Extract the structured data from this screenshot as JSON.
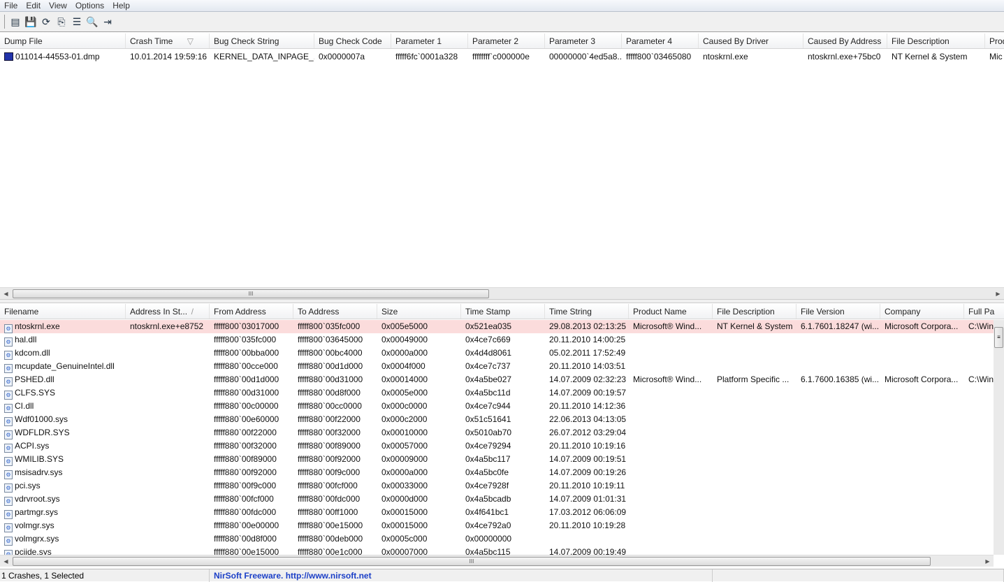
{
  "menu": [
    "File",
    "Edit",
    "View",
    "Options",
    "Help"
  ],
  "toolbar": [
    {
      "name": "html-report-icon",
      "glyph": "▤"
    },
    {
      "name": "save-icon",
      "glyph": "💾"
    },
    {
      "name": "refresh-icon",
      "glyph": "⟳"
    },
    {
      "name": "copy-icon",
      "glyph": "⎘"
    },
    {
      "name": "properties-icon",
      "glyph": "☰"
    },
    {
      "name": "find-icon",
      "glyph": "🔍"
    },
    {
      "name": "exit-icon",
      "glyph": "⇥"
    }
  ],
  "upper": {
    "columns": [
      "Dump File",
      "Crash Time",
      "Bug Check String",
      "Bug Check Code",
      "Parameter 1",
      "Parameter 2",
      "Parameter 3",
      "Parameter 4",
      "Caused By Driver",
      "Caused By Address",
      "File Description",
      "Product Name"
    ],
    "sort_indicator": "▽",
    "rows": [
      [
        "011014-44553-01.dmp",
        "10.01.2014 19:59:16",
        "KERNEL_DATA_INPAGE_...",
        "0x0000007a",
        "fffff6fc`0001a328",
        "ffffffff`c000000e",
        "00000000`4ed5a8...",
        "fffff800`03465080",
        "ntoskrnl.exe",
        "ntoskrnl.exe+75bc0",
        "NT Kernel & System",
        "Mic"
      ]
    ]
  },
  "lower": {
    "columns": [
      "Filename",
      "Address In St...",
      "From Address",
      "To Address",
      "Size",
      "Time Stamp",
      "Time String",
      "Product Name",
      "File Description",
      "File Version",
      "Company",
      "Full Pa"
    ],
    "sort_indicator": "/",
    "rows": [
      [
        "ntoskrnl.exe",
        "ntoskrnl.exe+e8752",
        "fffff800`03017000",
        "fffff800`035fc000",
        "0x005e5000",
        "0x521ea035",
        "29.08.2013 02:13:25",
        "Microsoft® Wind...",
        "NT Kernel & System",
        "6.1.7601.18247 (wi...",
        "Microsoft Corpora...",
        "C:\\Win"
      ],
      [
        "hal.dll",
        "",
        "fffff800`035fc000",
        "fffff800`03645000",
        "0x00049000",
        "0x4ce7c669",
        "20.11.2010 14:00:25",
        "",
        "",
        "",
        "",
        ""
      ],
      [
        "kdcom.dll",
        "",
        "fffff800`00bba000",
        "fffff800`00bc4000",
        "0x0000a000",
        "0x4d4d8061",
        "05.02.2011 17:52:49",
        "",
        "",
        "",
        "",
        ""
      ],
      [
        "mcupdate_GenuineIntel.dll",
        "",
        "fffff880`00cce000",
        "fffff880`00d1d000",
        "0x0004f000",
        "0x4ce7c737",
        "20.11.2010 14:03:51",
        "",
        "",
        "",
        "",
        ""
      ],
      [
        "PSHED.dll",
        "",
        "fffff880`00d1d000",
        "fffff880`00d31000",
        "0x00014000",
        "0x4a5be027",
        "14.07.2009 02:32:23",
        "Microsoft® Wind...",
        "Platform Specific ...",
        "6.1.7600.16385 (wi...",
        "Microsoft Corpora...",
        "C:\\Win"
      ],
      [
        "CLFS.SYS",
        "",
        "fffff880`00d31000",
        "fffff880`00d8f000",
        "0x0005e000",
        "0x4a5bc11d",
        "14.07.2009 00:19:57",
        "",
        "",
        "",
        "",
        ""
      ],
      [
        "CI.dll",
        "",
        "fffff880`00c00000",
        "fffff880`00cc0000",
        "0x000c0000",
        "0x4ce7c944",
        "20.11.2010 14:12:36",
        "",
        "",
        "",
        "",
        ""
      ],
      [
        "Wdf01000.sys",
        "",
        "fffff880`00e60000",
        "fffff880`00f22000",
        "0x000c2000",
        "0x51c51641",
        "22.06.2013 04:13:05",
        "",
        "",
        "",
        "",
        ""
      ],
      [
        "WDFLDR.SYS",
        "",
        "fffff880`00f22000",
        "fffff880`00f32000",
        "0x00010000",
        "0x5010ab70",
        "26.07.2012 03:29:04",
        "",
        "",
        "",
        "",
        ""
      ],
      [
        "ACPI.sys",
        "",
        "fffff880`00f32000",
        "fffff880`00f89000",
        "0x00057000",
        "0x4ce79294",
        "20.11.2010 10:19:16",
        "",
        "",
        "",
        "",
        ""
      ],
      [
        "WMILIB.SYS",
        "",
        "fffff880`00f89000",
        "fffff880`00f92000",
        "0x00009000",
        "0x4a5bc117",
        "14.07.2009 00:19:51",
        "",
        "",
        "",
        "",
        ""
      ],
      [
        "msisadrv.sys",
        "",
        "fffff880`00f92000",
        "fffff880`00f9c000",
        "0x0000a000",
        "0x4a5bc0fe",
        "14.07.2009 00:19:26",
        "",
        "",
        "",
        "",
        ""
      ],
      [
        "pci.sys",
        "",
        "fffff880`00f9c000",
        "fffff880`00fcf000",
        "0x00033000",
        "0x4ce7928f",
        "20.11.2010 10:19:11",
        "",
        "",
        "",
        "",
        ""
      ],
      [
        "vdrvroot.sys",
        "",
        "fffff880`00fcf000",
        "fffff880`00fdc000",
        "0x0000d000",
        "0x4a5bcadb",
        "14.07.2009 01:01:31",
        "",
        "",
        "",
        "",
        ""
      ],
      [
        "partmgr.sys",
        "",
        "fffff880`00fdc000",
        "fffff880`00ff1000",
        "0x00015000",
        "0x4f641bc1",
        "17.03.2012 06:06:09",
        "",
        "",
        "",
        "",
        ""
      ],
      [
        "volmgr.sys",
        "",
        "fffff880`00e00000",
        "fffff880`00e15000",
        "0x00015000",
        "0x4ce792a0",
        "20.11.2010 10:19:28",
        "",
        "",
        "",
        "",
        ""
      ],
      [
        "volmgrx.sys",
        "",
        "fffff880`00d8f000",
        "fffff880`00deb000",
        "0x0005c000",
        "0x00000000",
        "",
        "",
        "",
        "",
        "",
        ""
      ],
      [
        "pciide.sys",
        "",
        "fffff880`00e15000",
        "fffff880`00e1c000",
        "0x00007000",
        "0x4a5bc115",
        "14.07.2009 00:19:49",
        "",
        "",
        "",
        "",
        ""
      ]
    ]
  },
  "scroll_thumb": "III",
  "status": {
    "count": "1 Crashes, 1 Selected",
    "link": "NirSoft Freeware.  http://www.nirsoft.net"
  }
}
